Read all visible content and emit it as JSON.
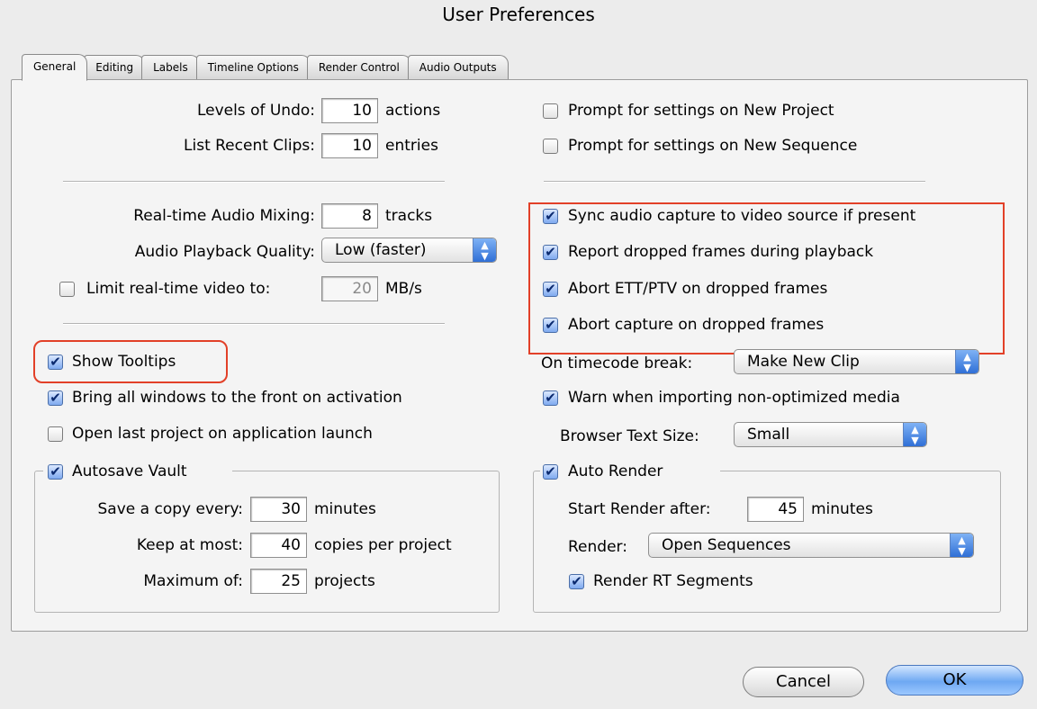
{
  "window": {
    "title": "User Preferences"
  },
  "tabs": [
    "General",
    "Editing",
    "Labels",
    "Timeline Options",
    "Render Control",
    "Audio Outputs"
  ],
  "left": {
    "undo": {
      "label": "Levels of Undo:",
      "value": "10",
      "unit": "actions"
    },
    "recent": {
      "label": "List Recent Clips:",
      "value": "10",
      "unit": "entries"
    },
    "audio_mixing": {
      "label": "Real-time Audio Mixing:",
      "value": "8",
      "unit": "tracks"
    },
    "playback_quality": {
      "label": "Audio Playback Quality:",
      "value": "Low (faster)"
    },
    "limit_video": {
      "label": "Limit real-time video to:",
      "value": "20",
      "unit": "MB/s",
      "checked": false
    },
    "show_tooltips": {
      "label": "Show Tooltips",
      "checked": true
    },
    "bring_windows": {
      "label": "Bring all windows to the front on activation",
      "checked": true
    },
    "open_last": {
      "label": "Open last project on application launch",
      "checked": false
    },
    "autosave": {
      "label": "Autosave Vault",
      "checked": true,
      "save_every": {
        "label": "Save a copy every:",
        "value": "30",
        "unit": "minutes"
      },
      "keep_at_most": {
        "label": "Keep at most:",
        "value": "40",
        "unit": "copies per project"
      },
      "maximum_of": {
        "label": "Maximum of:",
        "value": "25",
        "unit": "projects"
      }
    }
  },
  "right": {
    "prompt_project": {
      "label": "Prompt for settings on New Project",
      "checked": false
    },
    "prompt_sequence": {
      "label": "Prompt for settings on New Sequence",
      "checked": false
    },
    "sync_audio": {
      "label": "Sync audio capture to video source if present",
      "checked": true
    },
    "report_dropped": {
      "label": "Report dropped frames during playback",
      "checked": true
    },
    "abort_ett": {
      "label": "Abort ETT/PTV on dropped frames",
      "checked": true
    },
    "abort_capture": {
      "label": "Abort capture on dropped frames",
      "checked": true
    },
    "timecode_break": {
      "label": "On timecode break:",
      "value": "Make New Clip"
    },
    "warn_import": {
      "label": "Warn when importing non-optimized media",
      "checked": true
    },
    "browser_text": {
      "label": "Browser Text Size:",
      "value": "Small"
    },
    "auto_render": {
      "label": "Auto Render",
      "checked": true,
      "start_after": {
        "label": "Start Render after:",
        "value": "45",
        "unit": "minutes"
      },
      "render": {
        "label": "Render:",
        "value": "Open Sequences"
      },
      "rt_segments": {
        "label": "Render RT Segments",
        "checked": true
      }
    }
  },
  "buttons": {
    "cancel": "Cancel",
    "ok": "OK"
  },
  "colors": {
    "highlight": "#e24028",
    "accent": "#2f6fd6"
  },
  "glyphs": {
    "check": "✔",
    "select_arrows": "▲▼"
  }
}
